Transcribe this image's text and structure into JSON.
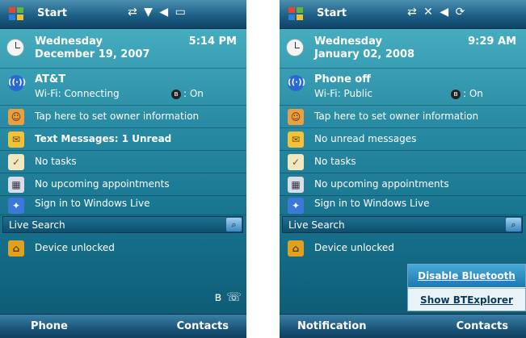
{
  "left": {
    "title": "Start",
    "status_icons": "⇄ ▼ ◀ ▭",
    "date_line1": "Wednesday",
    "date_line2": "December 19, 2007",
    "time": "5:14 PM",
    "network_name": "AT&T",
    "wifi_status": "Wi-Fi: Connecting",
    "bluetooth_status": ": On",
    "owner": "Tap here to set owner information",
    "messages": "Text Messages: 1 Unread",
    "tasks": "No tasks",
    "appointments": "No upcoming appointments",
    "live": "Sign in to Windows Live",
    "search_placeholder": "Live Search",
    "lock": "Device unlocked",
    "softkey_left": "Phone",
    "softkey_right": "Contacts"
  },
  "right": {
    "title": "Start",
    "status_icons": "⇄ ✕ ◀ ⟳",
    "date_line1": "Wednesday",
    "date_line2": "January 02, 2008",
    "time": "9:29 AM",
    "network_name": "Phone off",
    "wifi_status": "Wi-Fi: Public",
    "bluetooth_status": ": On",
    "owner": "Tap here to set owner information",
    "messages": "No unread messages",
    "tasks": "No tasks",
    "appointments": "No upcoming appointments",
    "live": "Sign in to Windows Live",
    "search_placeholder": "Live Search",
    "lock": "Device unlocked",
    "popup_item1": "Disable Bluetooth",
    "popup_item2": "Show BTExplorer",
    "softkey_left": "Notification",
    "softkey_right": "Contacts"
  },
  "icons": {
    "start": "windows-flag-icon",
    "clock": "clock-icon",
    "network": "antenna-icon",
    "owner": "person-icon",
    "messages": "envelope-icon",
    "tasks": "clipboard-icon",
    "appointments": "calendar-icon",
    "live": "windows-live-icon",
    "search": "search-icon",
    "lock": "padlock-icon",
    "bluetooth": "bluetooth-icon"
  },
  "colors": {
    "background_top": "#4fb6c8",
    "background_bottom": "#0c5770",
    "titlebar": "#1d5f86",
    "popup_highlight": "#1b78b2"
  }
}
